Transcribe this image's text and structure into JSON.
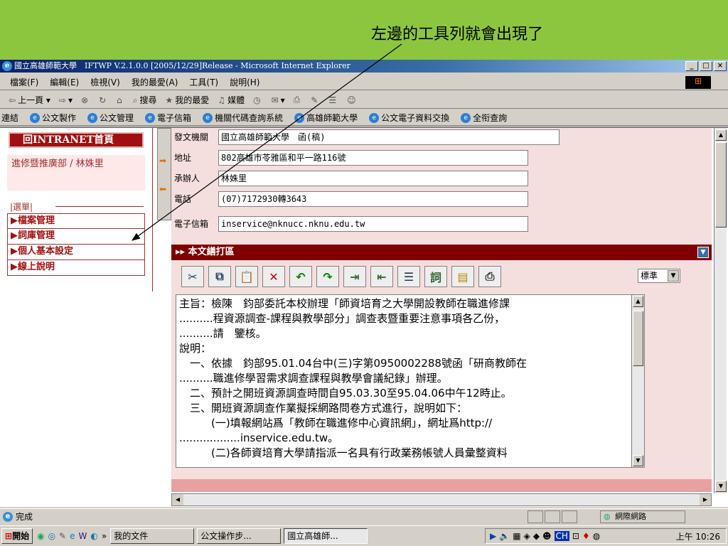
{
  "slide": {
    "caption": "左邊的工具列就會出現了"
  },
  "window": {
    "title": "國立高雄師範大學　IFTWP V.2.1.0.0 [2005/12/29]Release - Microsoft Internet Explorer",
    "buttons": [
      "_",
      "□",
      "×"
    ]
  },
  "menubar": {
    "items": [
      "檔案(F)",
      "編輯(E)",
      "檢視(V)",
      "我的最愛(A)",
      "工具(T)",
      "說明(H)"
    ]
  },
  "toolbar": {
    "back": "上一頁",
    "search": "搜尋",
    "favorites": "我的最愛",
    "media": "媒體"
  },
  "links": {
    "label": "連結",
    "items": [
      "公文製作",
      "公文管理",
      "電子信箱",
      "機關代碼查詢系統",
      "高雄師範大學",
      "公文電子資料交換",
      "全衔查詢"
    ]
  },
  "left": {
    "intranet_btn": "回INTRANET首頁",
    "dept": "進修暨推廣部 / 林姝里",
    "menu_label": "|選單|",
    "menu_items": [
      "▶檔案管理",
      "▶詞庫管理",
      "▶個人基本設定",
      "▶線上說明"
    ]
  },
  "form": {
    "fields": [
      {
        "label": "發文機關",
        "value": "國立高雄師範大學　函(稿)"
      },
      {
        "label": "地址",
        "value": "802高雄市苓雅區和平一路116號"
      },
      {
        "label": "承辦人",
        "value": "林姝里"
      },
      {
        "label": "電話",
        "value": "(07)7172930轉3643"
      },
      {
        "label": "電子信箱",
        "value": "inservice@nknucc.nknu.edu.tw"
      }
    ]
  },
  "editor": {
    "header": "▸▸ 本文繕打區",
    "style_select": "標準",
    "lines": [
      "主旨：檢陳　鈞部委託本校辦理「師資培育之大學開設教師在職進修課",
      "..........程資源調查-課程與教學部分」調查表暨重要注意事項各乙份，",
      "..........請　鑒核。",
      "說明：",
      "　一、依據　鈞部95.01.04台中(三)字第0950002288號函「研商教師在",
      "..........職進修學習需求調查課程與教學會議紀錄」辦理。",
      "　二、預計之開班資源調查時間自95.03.30至95.04.06中午12時止。",
      "　三、開班資源調查作業擬採網路問卷方式進行，說明如下：",
      "　　　(一)填報網站爲「教師在職進修中心資訊網」，網址爲http://",
      "..................inservice.edu.tw。",
      "　　　(二)各師資培育大學請指派一名具有行政業務帳號人員彙整資料"
    ]
  },
  "status": {
    "text": "完成",
    "zone": "網際網路"
  },
  "taskbar": {
    "start": "開始",
    "buttons": [
      "我的文件",
      "公文操作步...",
      "國立高雄師..."
    ],
    "clock": "上午 10:26"
  }
}
